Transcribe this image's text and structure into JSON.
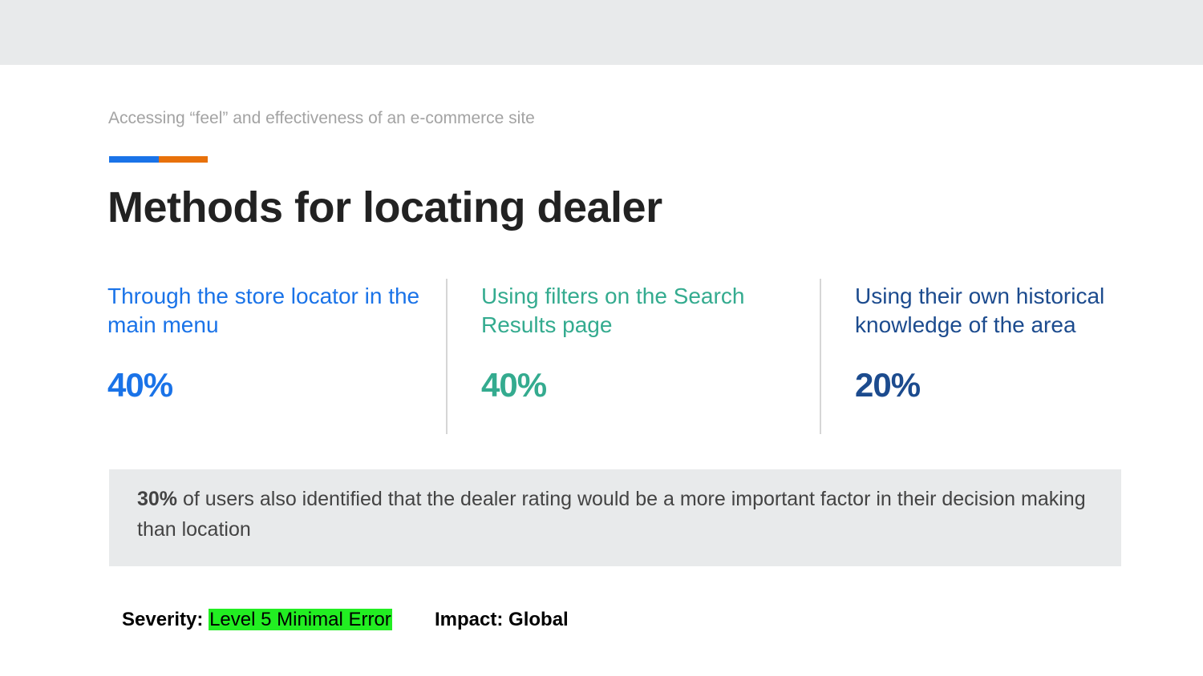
{
  "header": {
    "subtitle": "Accessing “feel” and effectiveness of an e-commerce site",
    "title": "Methods for locating dealer"
  },
  "colors": {
    "accent_blue": "#1a73e8",
    "accent_orange": "#e8710a",
    "col1": "#1a73e8",
    "col2": "#34ab8f",
    "col3": "#1c4b8e",
    "highlight": "#22ee22"
  },
  "methods": [
    {
      "label": "Through the store locator in the main menu",
      "value": "40%"
    },
    {
      "label": "Using filters on the Search Results page",
      "value": "40%"
    },
    {
      "label": "Using their own historical knowledge of the area",
      "value": "20%"
    }
  ],
  "callout": {
    "stat": "30%",
    "text": " of users also identified that the dealer rating would be a more important factor in their decision making than location"
  },
  "footer": {
    "severity_label": "Severity:",
    "severity_value": "Level 5  Minimal Error",
    "impact_label": "Impact:",
    "impact_value": "Global"
  }
}
